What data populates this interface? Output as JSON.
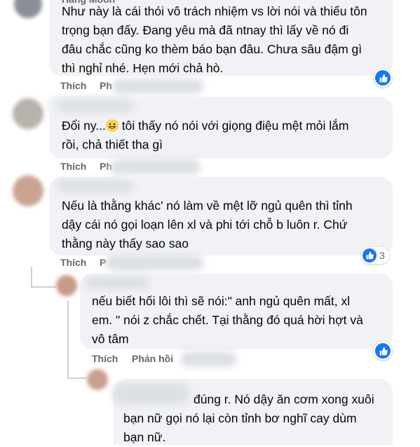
{
  "comments": [
    {
      "top_partial": "Hàng Moon",
      "text": "Như này là cái thói vô trách nhiệm vs lời nói và thiếu tôn\ntrọng bạn đấy. Đang yêu mà đã ntnay thì lấy về nó đi\nđâu chắc cũng ko thèm báo bạn đâu. Chưa sâu đậm gì\nthì nghỉ nhé. Hẹn mới chả hò.",
      "like_label": "Thích",
      "reply_label": "Ph"
    },
    {
      "text_before_emoji": "Đổi ny...",
      "text_after_emoji": " tôi thấy nó nói với giọng điệu mệt mỏi lắm\nrồi, chả thiết tha gì",
      "like_label": "Thích",
      "reply_label": "Ph"
    },
    {
      "text": "Nếu là thằng khác' nó làm về mệt lỡ ngủ quên thì tỉnh\ndậy cái nó gọi loạn lên xl và phi tới chỗ b luôn r. Chứ\nthằng này thấy sao sao",
      "like_label": "Thích",
      "reply_label": "P",
      "reaction_count": "3"
    },
    {
      "text": "nếu biết hối lôi thì sẽ nói:\" anh ngủ quên mất, xl\nem. \" nói z chắc chết. Tại thằng đó quá hời hợt và\nvô tâm",
      "like_label": "Thích",
      "reply_label": "Phản hồi"
    },
    {
      "text_line1": "đúng r. Nó dậy ăn cơm xong xuôi",
      "text_rest": "bạn nữ gọi nó lại còn tỉnh bơ nghĩ cay dùm\nbạn nữ."
    }
  ],
  "icons": {
    "like": "like-thumb-icon",
    "emoji": "grinning-emoji-icon"
  },
  "colors": {
    "bubble": "#f0f2f5",
    "like_blue": "#1877f2",
    "muted": "#65676b"
  }
}
